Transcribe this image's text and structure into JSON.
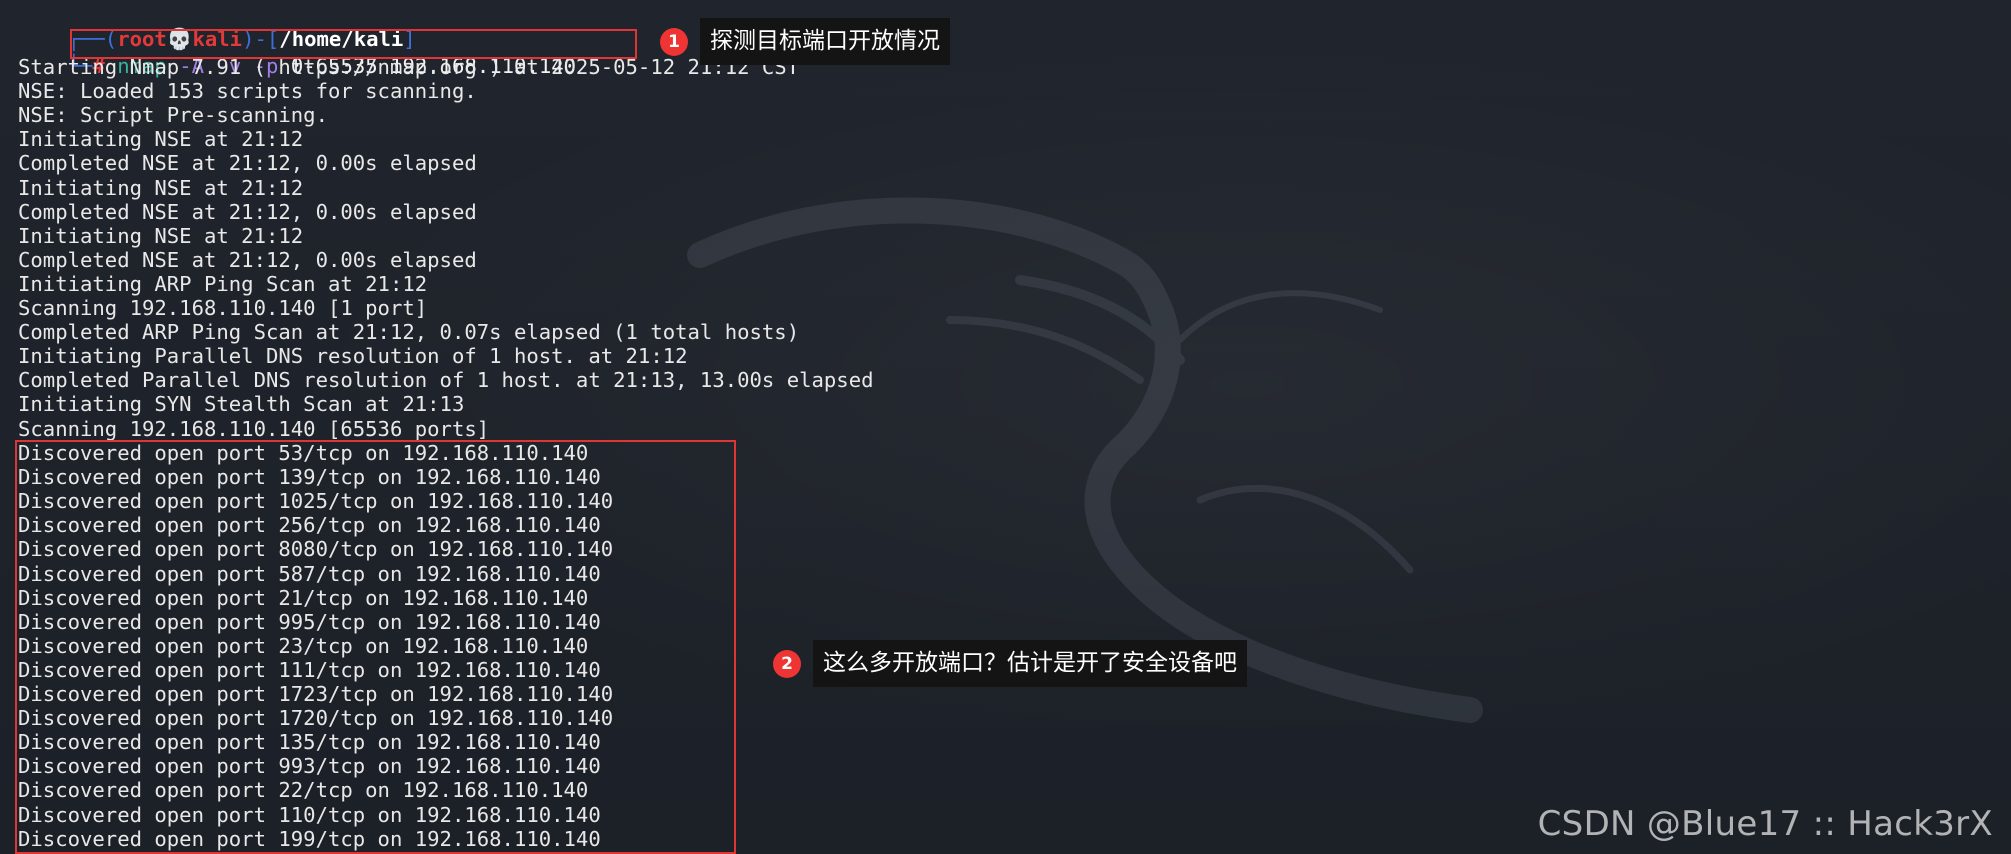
{
  "prompt": {
    "frame_open": "┌──(",
    "user": "root",
    "skull": "💀",
    "host": "kali",
    "frame_mid": ")-[",
    "path": "/home/kali",
    "frame_close": "]",
    "second_prefix": "└─",
    "hash": "#"
  },
  "command": {
    "name": "nmap",
    "flags": "-A -v -p",
    "range": "0-65535",
    "target": "192.168.110.140"
  },
  "output": {
    "pre_lines": [
      "Starting Nmap 7.91 ( https://nmap.org ) at 2025-05-12 21:12 CST",
      "NSE: Loaded 153 scripts for scanning.",
      "NSE: Script Pre-scanning.",
      "Initiating NSE at 21:12",
      "Completed NSE at 21:12, 0.00s elapsed",
      "Initiating NSE at 21:12",
      "Completed NSE at 21:12, 0.00s elapsed",
      "Initiating NSE at 21:12",
      "Completed NSE at 21:12, 0.00s elapsed",
      "Initiating ARP Ping Scan at 21:12",
      "Scanning 192.168.110.140 [1 port]",
      "Completed ARP Ping Scan at 21:12, 0.07s elapsed (1 total hosts)",
      "Initiating Parallel DNS resolution of 1 host. at 21:12",
      "Completed Parallel DNS resolution of 1 host. at 21:13, 13.00s elapsed",
      "Initiating SYN Stealth Scan at 21:13",
      "Scanning 192.168.110.140 [65536 ports]"
    ],
    "open_ports": [
      "Discovered open port 53/tcp on 192.168.110.140",
      "Discovered open port 139/tcp on 192.168.110.140",
      "Discovered open port 1025/tcp on 192.168.110.140",
      "Discovered open port 256/tcp on 192.168.110.140",
      "Discovered open port 8080/tcp on 192.168.110.140",
      "Discovered open port 587/tcp on 192.168.110.140",
      "Discovered open port 21/tcp on 192.168.110.140",
      "Discovered open port 995/tcp on 192.168.110.140",
      "Discovered open port 23/tcp on 192.168.110.140",
      "Discovered open port 111/tcp on 192.168.110.140",
      "Discovered open port 1723/tcp on 192.168.110.140",
      "Discovered open port 1720/tcp on 192.168.110.140",
      "Discovered open port 135/tcp on 192.168.110.140",
      "Discovered open port 993/tcp on 192.168.110.140",
      "Discovered open port 22/tcp on 192.168.110.140",
      "Discovered open port 110/tcp on 192.168.110.140",
      "Discovered open port 199/tcp on 192.168.110.140"
    ]
  },
  "annotations": [
    {
      "number": "1",
      "text": "探测目标端口开放情况"
    },
    {
      "number": "2",
      "text": "这么多开放端口？估计是开了安全设备吧"
    }
  ],
  "watermark": "CSDN @Blue17 :: Hack3rX",
  "colors": {
    "background": "#1f232b",
    "prompt_frame": "#3e6fd8",
    "prompt_user": "#e23a3a",
    "command": "#36b39d",
    "flags": "#a37ee6",
    "highlight_box": "#e03535",
    "badge": "#ef3434"
  },
  "icons": {
    "background_logo": "kali-dragon-icon",
    "skull": "skull-icon"
  }
}
